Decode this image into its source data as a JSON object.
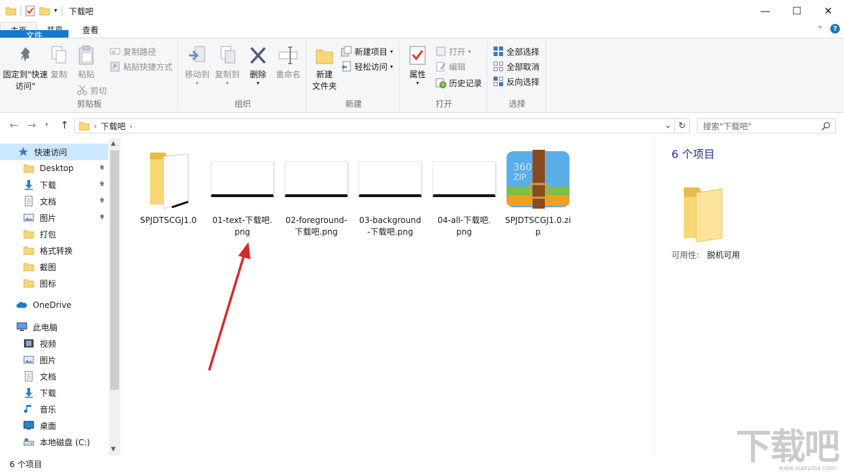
{
  "window": {
    "title": "下载吧",
    "minimize": "—",
    "maximize": "☐",
    "close": "✕"
  },
  "tabs": [
    "文件",
    "主页",
    "共享",
    "查看"
  ],
  "ribbon": {
    "clipboard": {
      "label": "剪贴板",
      "pin_quick": "固定到\"快速访问\"",
      "copy": "复制",
      "paste": "粘贴",
      "copy_path": "复制路径",
      "paste_shortcut": "粘贴快捷方式",
      "cut": "剪切"
    },
    "organize": {
      "label": "组织",
      "move_to": "移动到",
      "copy_to": "复制到",
      "delete": "删除",
      "rename": "重命名"
    },
    "new": {
      "label": "新建",
      "new_folder": "新建\n文件夹",
      "new_item": "新建项目",
      "easy_access": "轻松访问"
    },
    "open": {
      "label": "打开",
      "properties": "属性",
      "open": "打开",
      "edit": "编辑",
      "history": "历史记录"
    },
    "select": {
      "label": "选择",
      "select_all": "全部选择",
      "select_none": "全部取消",
      "invert": "反向选择"
    }
  },
  "address": {
    "path": "下载吧",
    "search_placeholder": "搜索\"下载吧\""
  },
  "nav": {
    "quick_access": "快速访问",
    "items": [
      {
        "label": "Desktop",
        "icon": "folder-icon",
        "pinned": true
      },
      {
        "label": "下载",
        "icon": "download-icon",
        "pinned": true
      },
      {
        "label": "文档",
        "icon": "document-icon",
        "pinned": true
      },
      {
        "label": "图片",
        "icon": "picture-icon",
        "pinned": true
      },
      {
        "label": "打包",
        "icon": "folder-icon",
        "pinned": false
      },
      {
        "label": "格式转换",
        "icon": "folder-icon",
        "pinned": false
      },
      {
        "label": "截图",
        "icon": "folder-icon",
        "pinned": false
      },
      {
        "label": "图标",
        "icon": "folder-icon",
        "pinned": false
      }
    ],
    "onedrive": "OneDrive",
    "this_pc": "此电脑",
    "pc_items": [
      {
        "label": "视频",
        "icon": "video-icon"
      },
      {
        "label": "图片",
        "icon": "picture-icon"
      },
      {
        "label": "文档",
        "icon": "document-icon"
      },
      {
        "label": "下载",
        "icon": "download-icon"
      },
      {
        "label": "音乐",
        "icon": "music-icon"
      },
      {
        "label": "桌面",
        "icon": "desktop-icon"
      },
      {
        "label": "本地磁盘 (C:)",
        "icon": "drive-icon"
      }
    ]
  },
  "files": [
    {
      "name": "SPJDTSCGJ1.0",
      "type": "folder"
    },
    {
      "name": "01-text-下载吧.\npng",
      "type": "png"
    },
    {
      "name": "02-foreground-\n下载吧.png",
      "type": "png"
    },
    {
      "name": "03-background\n-下载吧.png",
      "type": "png"
    },
    {
      "name": "04-all-下载吧.\npng",
      "type": "png"
    },
    {
      "name": "SPJDTSCGJ1.0.zi\np",
      "type": "zip"
    }
  ],
  "zip_icon_text": "360\nZIP",
  "details": {
    "count": "6 个项目",
    "availability_key": "可用性:",
    "availability_value": "脱机可用"
  },
  "status": {
    "count": "6 个项目"
  },
  "watermark": {
    "text": "下载吧",
    "url": "www.xiazaiba.com"
  },
  "colors": {
    "accent": "#1979ca",
    "folder": "#f8d775",
    "arrow": "#d42a2a",
    "selection": "#cce8ff"
  }
}
